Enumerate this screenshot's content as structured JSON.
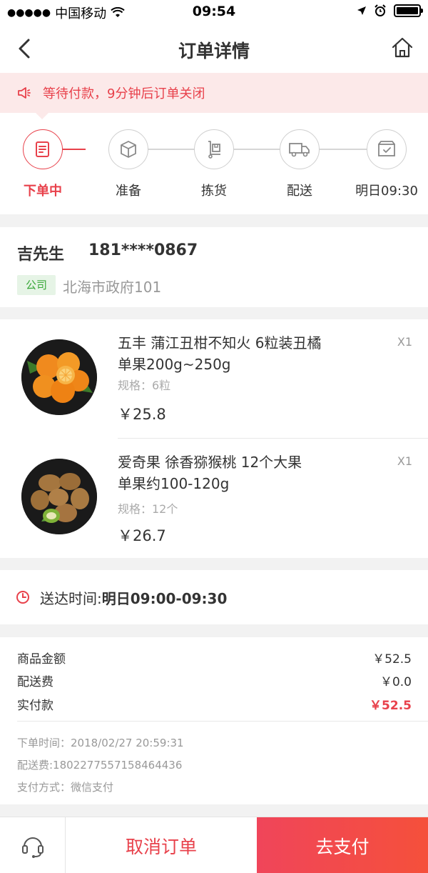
{
  "status_bar": {
    "carrier": "中国移动",
    "time": "09:54"
  },
  "nav": {
    "title": "订单详情",
    "back_icon": "chevron-left-icon",
    "home_icon": "home-icon"
  },
  "notice": {
    "icon": "megaphone-icon",
    "text": "等待付款，9分钟后订单关闭"
  },
  "progress": {
    "steps": [
      {
        "label": "下单中",
        "icon": "order-form-icon",
        "active": true
      },
      {
        "label": "准备",
        "icon": "package-box-icon",
        "active": false
      },
      {
        "label": "拣货",
        "icon": "hand-cart-icon",
        "active": false
      },
      {
        "label": "配送",
        "icon": "delivery-truck-icon",
        "active": false
      },
      {
        "label": "明日09:30",
        "icon": "delivered-box-icon",
        "active": false
      }
    ]
  },
  "address": {
    "name": "吉先生",
    "phone": "181****0867",
    "tag": "公司",
    "detail": "北海市政府101"
  },
  "products": [
    {
      "name_line1": "五丰 蒲江丑柑不知火 6粒装丑橘",
      "name_line2": "单果200g~250g",
      "quantity": "X1",
      "spec": "规格：6粒",
      "price": "￥25.8"
    },
    {
      "name_line1": "爱奇果 徐香猕猴桃 12个大果",
      "name_line2": "单果约100-120g",
      "quantity": "X1",
      "spec": "规格：12个",
      "price": "￥26.7"
    }
  ],
  "delivery": {
    "label": "送达时间:",
    "value": "明日09:00-09:30"
  },
  "totals": {
    "goods_label": "商品金额",
    "goods_value": "￥52.5",
    "shipping_label": "配送费",
    "shipping_value": "￥0.0",
    "paid_label": "实付款",
    "paid_value": "￥52.5",
    "order_time": "下单时间：2018/02/27 20:59:31",
    "order_no": "配送费:1802277557158464436",
    "pay_method": "支付方式：微信支付"
  },
  "bottom": {
    "service_icon": "headset-icon",
    "cancel_label": "取消订单",
    "pay_label": "去支付"
  },
  "colors": {
    "accent": "#e8414b",
    "notice_bg": "#fce9e9",
    "tag_green": "#39a839"
  }
}
